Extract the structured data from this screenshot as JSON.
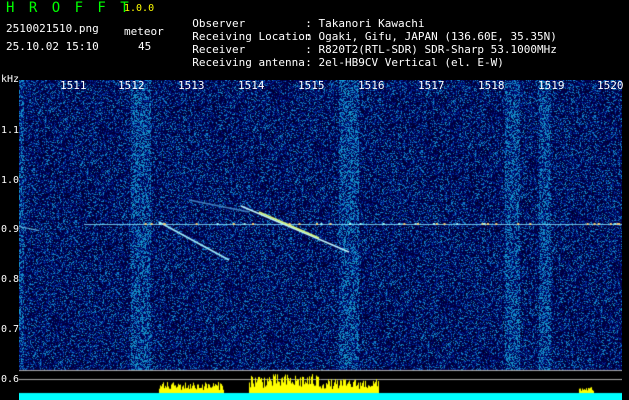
{
  "app": {
    "title": "H R O F F T",
    "version": "1.0.0"
  },
  "file": {
    "name": "2510021510.png",
    "datetime": "25.10.02 15:10"
  },
  "detection": {
    "type_label": "meteor",
    "count": "45"
  },
  "info": [
    {
      "key": "Observer",
      "value": ": Takanori Kawachi"
    },
    {
      "key": "Receiving Location",
      "value": ": Ogaki, Gifu, JAPAN (136.60E, 35.35N)"
    },
    {
      "key": "Receiver",
      "value": ": R820T2(RTL-SDR) SDR-Sharp 53.1000MHz"
    },
    {
      "key": "Receiving antenna",
      "value": ": 2el-HB9CV Vertical (el. E-W)"
    }
  ],
  "axes": {
    "y_unit": "kHz",
    "y_ticks": [
      "1.1",
      "1.0",
      "0.9",
      "0.8",
      "0.7",
      "0.6"
    ],
    "x_ticks": [
      "1511",
      "1512",
      "1513",
      "1514",
      "1515",
      "1516",
      "1517",
      "1518",
      "1519",
      "1520"
    ]
  },
  "colors": {
    "title": "#00ff00",
    "version": "#ffff00",
    "background": "#000010",
    "carrier": "#7fe0ff",
    "activity": "#ffff00",
    "baseline": "#00ffff"
  }
}
